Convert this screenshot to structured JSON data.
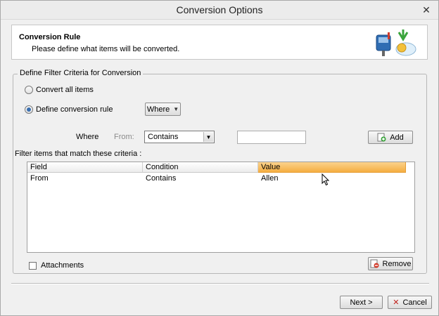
{
  "window": {
    "title": "Conversion Options"
  },
  "header": {
    "title": "Conversion Rule",
    "subtitle": "Please define what items will be converted."
  },
  "filter_group": {
    "legend": "Define Filter Criteria for Conversion",
    "options": [
      {
        "label": "Convert all items",
        "selected": false
      },
      {
        "label": "Define conversion rule",
        "selected": true
      }
    ],
    "where_button": "Where",
    "rule_where_label": "Where",
    "rule_field_label": "From:",
    "condition_value": "Contains",
    "value_input": "",
    "add_button": "Add",
    "match_label": "Filter items that match these criteria :",
    "grid": {
      "columns": [
        "Field",
        "Condition",
        "Value"
      ],
      "rows": [
        {
          "field": "From",
          "condition": "Contains",
          "value": "Allen"
        }
      ]
    },
    "attachments_label": "Attachments",
    "attachments_checked": false,
    "remove_button": "Remove"
  },
  "footer": {
    "next_button": "Next >",
    "cancel_button": "Cancel"
  },
  "colors": {
    "sorted_column": "#f5ae41",
    "window_bg": "#f0f0f0"
  }
}
